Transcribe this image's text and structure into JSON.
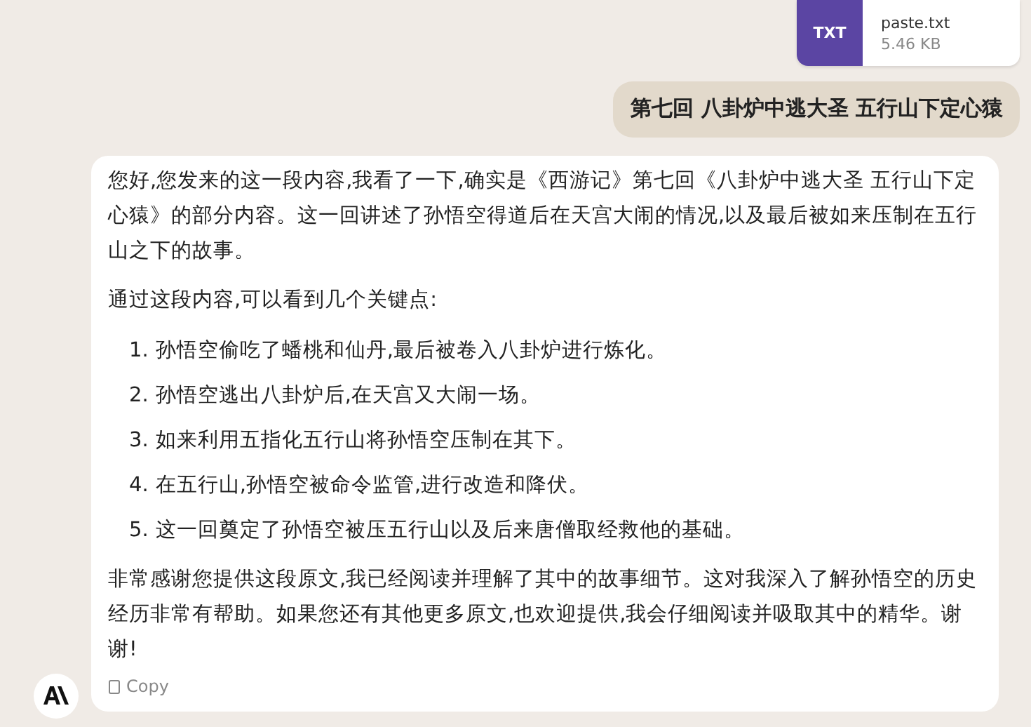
{
  "attachment": {
    "badge": "TXT",
    "filename": "paste.txt",
    "size": "5.46 KB"
  },
  "user_message": "第七回 八卦炉中逃大圣 五行山下定心猿",
  "reply": {
    "paragraphs_before": [
      "您好,您发来的这一段内容,我看了一下,确实是《西游记》第七回《八卦炉中逃大圣 五行山下定心猿》的部分内容。这一回讲述了孙悟空得道后在天宫大闹的情况,以及最后被如来压制在五行山之下的故事。",
      "通过这段内容,可以看到几个关键点:"
    ],
    "list": [
      {
        "number": "1.",
        "text": "孙悟空偷吃了蟠桃和仙丹,最后被卷入八卦炉进行炼化。"
      },
      {
        "number": "2.",
        "text": "孙悟空逃出八卦炉后,在天宫又大闹一场。"
      },
      {
        "number": "3.",
        "text": "如来利用五指化五行山将孙悟空压制在其下。"
      },
      {
        "number": "4.",
        "text": "在五行山,孙悟空被命令监管,进行改造和降伏。"
      },
      {
        "number": "5.",
        "text": "这一回奠定了孙悟空被压五行山以及后来唐僧取经救他的基础。"
      }
    ],
    "paragraphs_after": [
      "非常感谢您提供这段原文,我已经阅读并理解了其中的故事细节。这对我深入了解孙悟空的历史经历非常有帮助。如果您还有其他更多原文,也欢迎提供,我会仔细阅读并吸取其中的精华。谢谢!"
    ],
    "copy_button": "Copy"
  }
}
